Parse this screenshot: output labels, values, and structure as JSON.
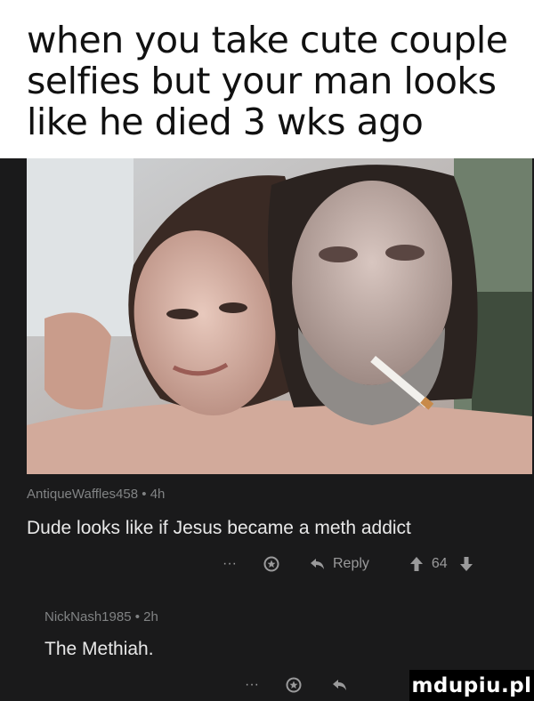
{
  "meme": {
    "caption_lines": [
      "when you take cute couple",
      "selfies but your man looks",
      "like he died 3 wks ago"
    ]
  },
  "photo": {
    "description_icon": "selfie-photo"
  },
  "comments": [
    {
      "username": "AntiqueWaffles458",
      "separator": "•",
      "age": "4h",
      "body": "Dude looks like if Jesus became a meth addict",
      "more": "···",
      "award_icon": "award-icon",
      "reply_label": "Reply",
      "score": "64"
    },
    {
      "username": "NickNash1985",
      "separator": "•",
      "age": "2h",
      "body": "The Methiah.",
      "more": "···",
      "award_icon": "award-icon",
      "reply_icon": "reply-icon"
    }
  ],
  "watermark": "mdupiu.pl",
  "colors": {
    "background": "#1a1a1b",
    "meta_text": "#818384",
    "body_text": "#e8e8e8",
    "upvote": "#9a9a9b"
  }
}
